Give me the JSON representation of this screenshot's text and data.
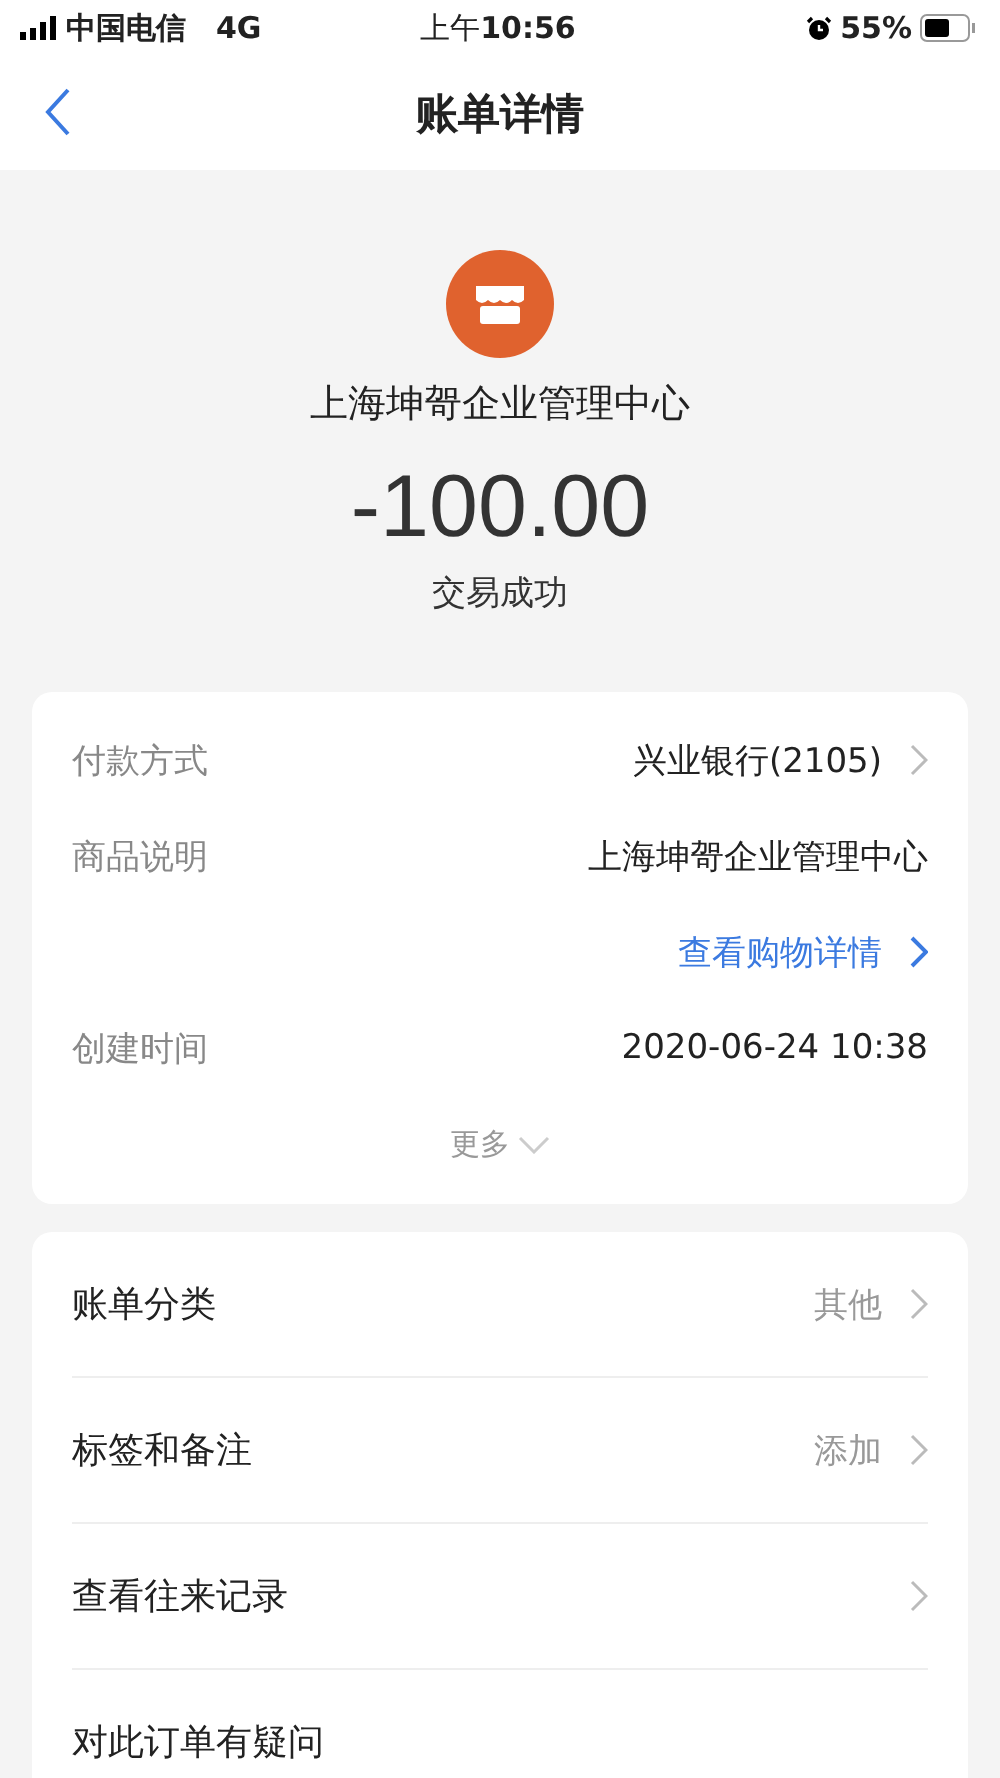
{
  "status_bar": {
    "carrier": "中国电信",
    "network": "4G",
    "time_prefix": "上午",
    "time": "10:56",
    "battery": "55%"
  },
  "nav": {
    "title": "账单详情"
  },
  "merchant": {
    "name": "上海坤哿企业管理中心",
    "amount": "-100.00",
    "status": "交易成功"
  },
  "details": [
    {
      "kind": "field",
      "label": "付款方式",
      "value": "兴业银行(2105)",
      "chevron": true
    },
    {
      "kind": "field",
      "label": "商品说明",
      "value": "上海坤哿企业管理中心",
      "chevron": false
    },
    {
      "kind": "link",
      "value": "查看购物详情",
      "chevron": true
    },
    {
      "kind": "field",
      "label": "创建时间",
      "value": "2020-06-24 10:38",
      "chevron": false
    }
  ],
  "more": "更多",
  "menu": [
    {
      "label": "账单分类",
      "value": "其他",
      "chevron": true
    },
    {
      "label": "标签和备注",
      "value": "添加",
      "chevron": true
    },
    {
      "label": "查看往来记录",
      "chevron": true
    },
    {
      "label": "对此订单有疑问",
      "chevron": false
    }
  ]
}
